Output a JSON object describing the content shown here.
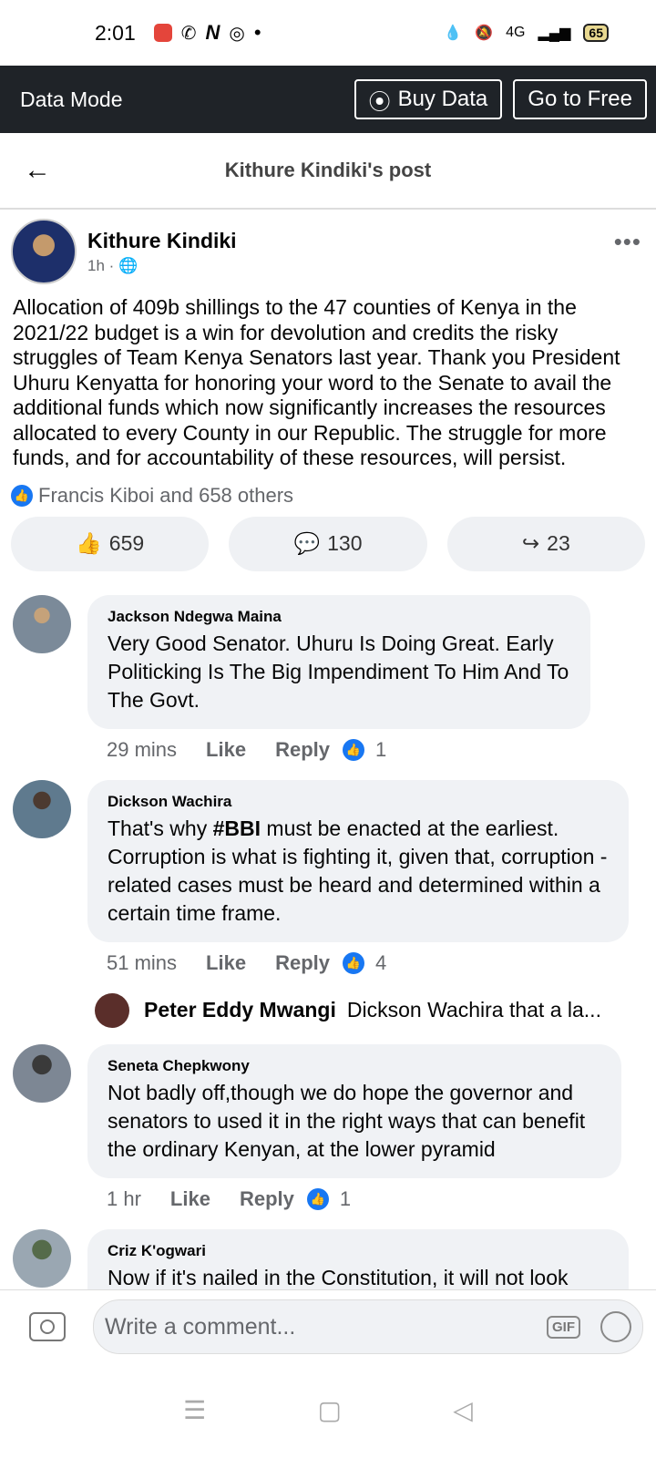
{
  "status": {
    "time": "2:01",
    "network": "4G",
    "battery": "65"
  },
  "data_bar": {
    "title": "Data Mode",
    "buy_label": "Buy Data",
    "free_label": "Go to Free"
  },
  "header": {
    "title": "Kithure Kindiki's post"
  },
  "post": {
    "author": "Kithure Kindiki",
    "time": "1h",
    "text": "Allocation of 409b shillings to the 47 counties of Kenya  in the 2021/22 budget is a win for devolution and credits the risky struggles of Team Kenya Senators last year. Thank you President Uhuru Kenyatta for honoring your word to the Senate to avail the additional funds which now significantly increases the resources allocated to every County in our Republic. The struggle for more funds, and for accountability of these resources, will persist.",
    "reactions_text": "Francis Kiboi and 658 others",
    "likes": "659",
    "comments": "130",
    "shares": "23"
  },
  "comments": [
    {
      "name": "Jackson Ndegwa Maina",
      "text": "Very Good Senator. Uhuru Is Doing Great. Early Politicking Is The Big Impendiment To Him And To The Govt.",
      "time": "29 mins",
      "like_label": "Like",
      "reply_label": "Reply",
      "reactions": "1"
    },
    {
      "name": "Dickson Wachira",
      "text_before": "That's why ",
      "text_bold": "#BBI",
      "text_after": " must be enacted at the earliest. Corruption is what is fighting it, given that, corruption -related cases must be heard and determined within a certain time frame.",
      "time": "51 mins",
      "like_label": "Like",
      "reply_label": "Reply",
      "reactions": "4"
    },
    {
      "name": "Seneta Chepkwony",
      "text": "Not badly off,though we do hope the governor and senators to used it in the right ways that can benefit the ordinary Kenyan, at the lower pyramid",
      "time": "1 hr",
      "like_label": "Like",
      "reply_label": "Reply",
      "reactions": "1"
    },
    {
      "name": "Criz K'ogwari",
      "text": "Now if it's nailed in the Constitution, it will not look"
    }
  ],
  "reply_preview": {
    "name": "Peter Eddy Mwangi",
    "text": "Dickson Wachira that a la..."
  },
  "composer": {
    "placeholder": "Write a comment...",
    "gif": "GIF"
  },
  "colors": {
    "accent": "#1877f2",
    "data_bar_bg": "#1f2328",
    "bubble_bg": "#f0f2f5"
  }
}
